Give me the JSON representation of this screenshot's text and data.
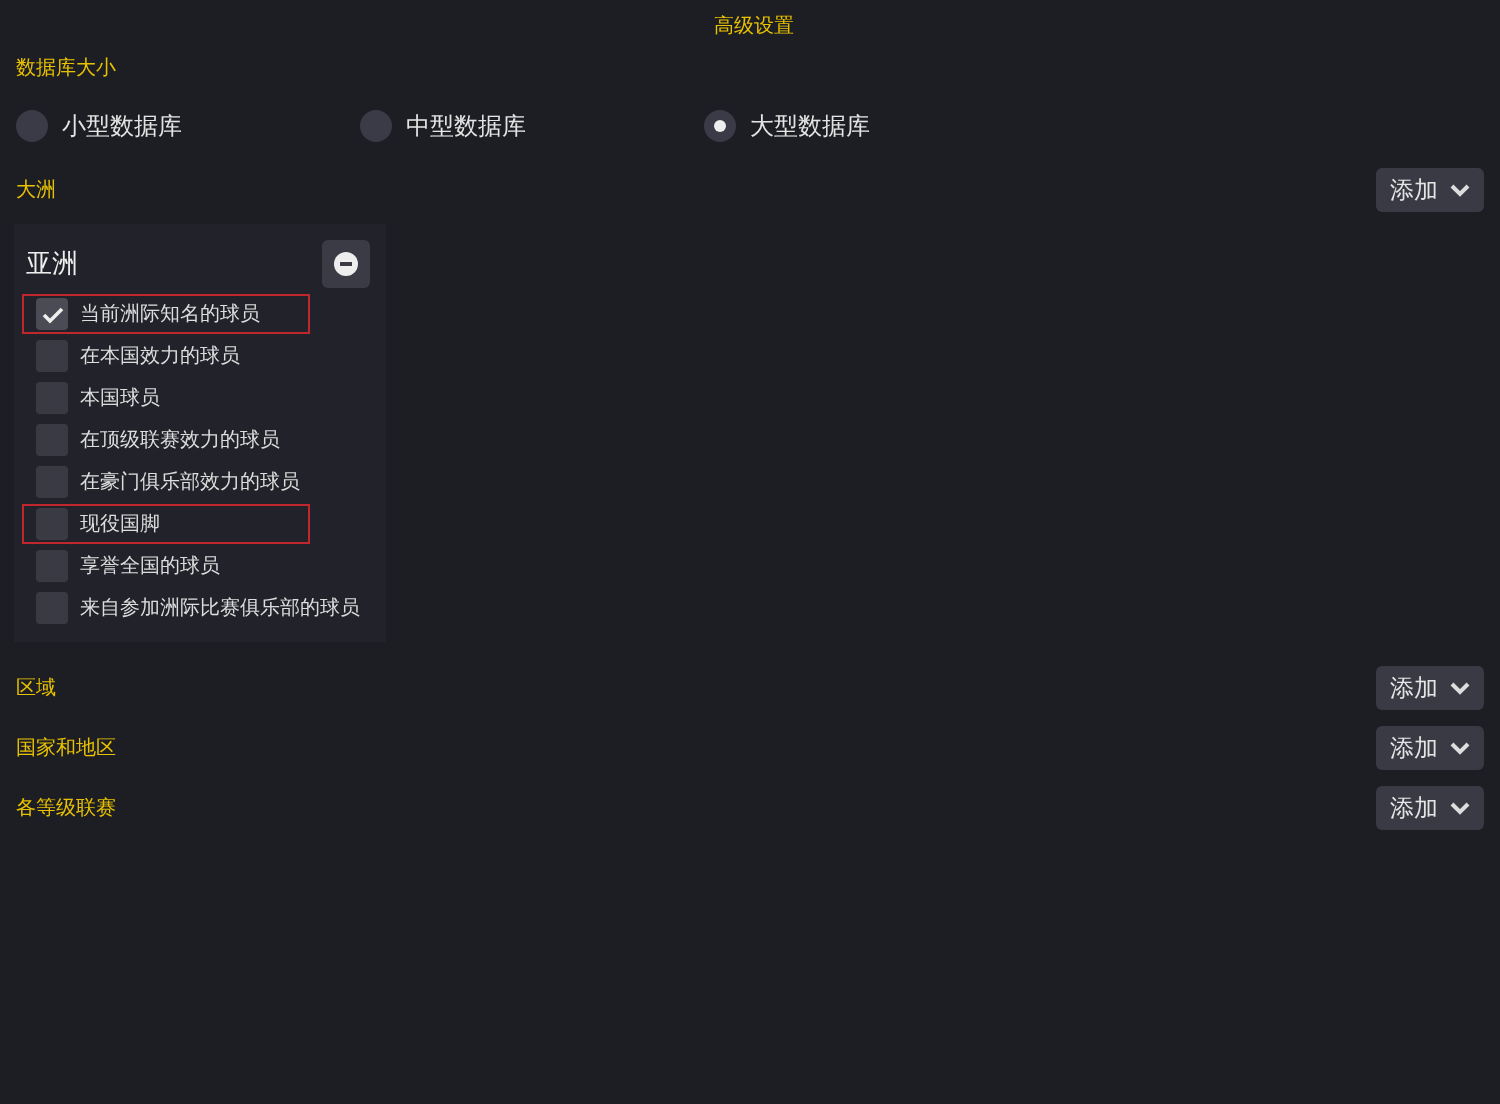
{
  "title": "高级设置",
  "database_size": {
    "label": "数据库大小",
    "options": [
      {
        "label": "小型数据库",
        "selected": false
      },
      {
        "label": "中型数据库",
        "selected": false
      },
      {
        "label": "大型数据库",
        "selected": true
      }
    ]
  },
  "continent": {
    "label": "大洲",
    "add_button": "添加",
    "card": {
      "title": "亚洲",
      "items": [
        {
          "label": "当前洲际知名的球员",
          "checked": true,
          "highlighted": true
        },
        {
          "label": "在本国效力的球员",
          "checked": false,
          "highlighted": false
        },
        {
          "label": "本国球员",
          "checked": false,
          "highlighted": false
        },
        {
          "label": "在顶级联赛效力的球员",
          "checked": false,
          "highlighted": false
        },
        {
          "label": "在豪门俱乐部效力的球员",
          "checked": false,
          "highlighted": false
        },
        {
          "label": "现役国脚",
          "checked": false,
          "highlighted": true
        },
        {
          "label": "享誉全国的球员",
          "checked": false,
          "highlighted": false
        },
        {
          "label": "来自参加洲际比赛俱乐部的球员",
          "checked": false,
          "highlighted": false
        }
      ]
    }
  },
  "sections": [
    {
      "label": "区域",
      "add_button": "添加"
    },
    {
      "label": "国家和地区",
      "add_button": "添加"
    },
    {
      "label": "各等级联赛",
      "add_button": "添加"
    }
  ]
}
